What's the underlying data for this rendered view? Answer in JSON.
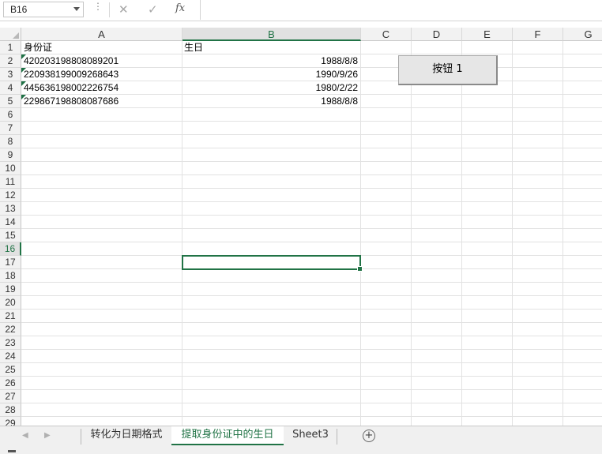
{
  "formula_bar": {
    "name_box": "B16",
    "formula": ""
  },
  "icons": {
    "more": "more-vertical-icon",
    "cancel": "close-icon",
    "enter": "check-icon",
    "function": "fx-icon",
    "add_sheet": "plus-circle-icon"
  },
  "columns": [
    "A",
    "B",
    "C",
    "D",
    "E",
    "F",
    "G"
  ],
  "selected_column": "B",
  "rows": [
    "1",
    "2",
    "3",
    "4",
    "5",
    "6",
    "7",
    "8",
    "9",
    "10",
    "11",
    "12",
    "13",
    "14",
    "15",
    "16",
    "17",
    "18",
    "19",
    "20",
    "21",
    "22",
    "23",
    "24",
    "25",
    "26",
    "27",
    "28",
    "29"
  ],
  "selected_row": "16",
  "headers": {
    "id_card": "身份证",
    "birthday": "生日"
  },
  "data_rows": [
    {
      "id": "420203198808089201",
      "birthday": "1988/8/8"
    },
    {
      "id": "220938199009268643",
      "birthday": "1990/9/26"
    },
    {
      "id": "445636198002226754",
      "birthday": "1980/2/22"
    },
    {
      "id": "229867198808087686",
      "birthday": "1988/8/8"
    }
  ],
  "form_button": {
    "label": "按钮 1"
  },
  "sheet_tabs": [
    {
      "label": "转化为日期格式",
      "active": false
    },
    {
      "label": "提取身份证中的生日",
      "active": true
    },
    {
      "label": "Sheet3",
      "active": false
    }
  ],
  "colors": {
    "accent": "#217346",
    "header_bg": "#f2f2f2",
    "gridline": "#e2e2e2"
  }
}
